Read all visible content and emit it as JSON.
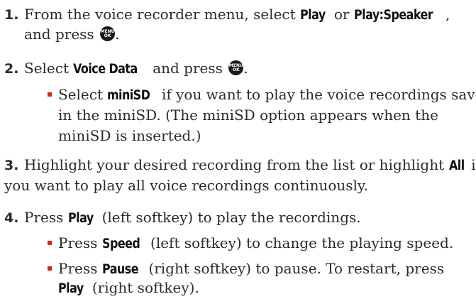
{
  "steps": [
    {
      "num": "1.",
      "l1a": "From the voice recorder menu, select ",
      "l1b": "Play",
      "l1c": " or ",
      "l1d": "Play:Speaker",
      "l1e": ",",
      "l2a": "and press ",
      "l2b": "."
    },
    {
      "num": "2.",
      "a": "Select ",
      "b": "Voice Data",
      "c": " and press ",
      "d": "."
    },
    {
      "num": "3.",
      "l1a": "Highlight your desired recording from the list or highlight ",
      "l1b": "All",
      "l1c": " if",
      "l2": "you want to play all voice recordings continuously."
    },
    {
      "num": "4.",
      "a": "Press ",
      "b": "Play",
      "c": " (left softkey) to play the recordings."
    }
  ],
  "sub2": {
    "l1a": "Select ",
    "l1b": "miniSD",
    "l1c": " if you want to play the voice recordings saved",
    "l2": "in the miniSD. (The miniSD option appears when the",
    "l3": "miniSD is inserted.)"
  },
  "sub4a": {
    "a": "Press ",
    "b": "Speed",
    "c": " (left softkey) to change the playing speed."
  },
  "sub4b": {
    "l1a": "Press ",
    "l1b": "Pause",
    "l1c": " (right softkey) to pause. To restart, press",
    "l2a": "Play",
    "l2b": " (right softkey)."
  },
  "menu_key": {
    "top": "MENU",
    "bottom": "OK"
  },
  "colors": {
    "bullet": "#d9241b",
    "text": "#2a2a2a"
  }
}
